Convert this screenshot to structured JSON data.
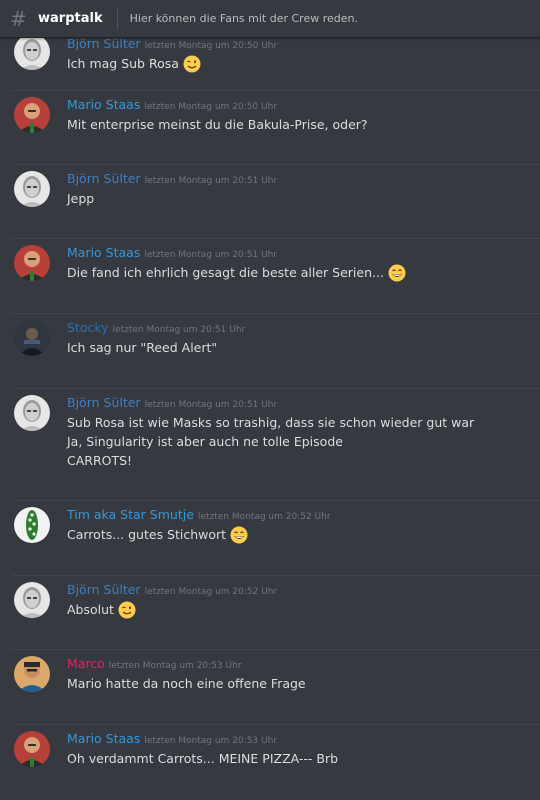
{
  "channel": {
    "name": "warptalk",
    "topic": "Hier können die Fans mit der Crew reden."
  },
  "colors": {
    "bjoern": "#3d7fc2",
    "mario": "#3498db",
    "stocky": "#2d6fb0",
    "tim": "#3498db",
    "marco": "#e91e63"
  },
  "messages": [
    {
      "author": "Björn Sülter",
      "color_key": "bjoern",
      "avatar": "bjoern-avatar",
      "time": "letzten Montag um 20:50 Uhr",
      "lines": [
        {
          "text": "Ich mag Sub Rosa",
          "emoji": "wink-emoji"
        }
      ]
    },
    {
      "author": "Mario Staas",
      "color_key": "mario",
      "avatar": "mario-avatar",
      "time": "letzten Montag um 20:50 Uhr",
      "lines": [
        {
          "text": "Mit enterprise meinst du die Bakula-Prise, oder?"
        }
      ]
    },
    {
      "author": "Björn Sülter",
      "color_key": "bjoern",
      "avatar": "bjoern-avatar",
      "time": "letzten Montag um 20:51 Uhr",
      "lines": [
        {
          "text": "Jepp"
        }
      ]
    },
    {
      "author": "Mario Staas",
      "color_key": "mario",
      "avatar": "mario-avatar",
      "time": "letzten Montag um 20:51 Uhr",
      "lines": [
        {
          "text": "Die fand ich ehrlich gesagt die beste aller Serien...",
          "emoji": "smile-emoji"
        }
      ]
    },
    {
      "author": "Stocky",
      "color_key": "stocky",
      "avatar": "stocky-avatar",
      "time": "letzten Montag um 20:51 Uhr",
      "lines": [
        {
          "text": "Ich sag nur \"Reed Alert\""
        }
      ]
    },
    {
      "author": "Björn Sülter",
      "color_key": "bjoern",
      "avatar": "bjoern-avatar",
      "time": "letzten Montag um 20:51 Uhr",
      "lines": [
        {
          "text": "Sub Rosa ist wie Masks so trashig, dass sie schon wieder gut war"
        },
        {
          "text": "Ja, Singularity ist aber auch ne tolle Episode"
        },
        {
          "text": "CARROTS!"
        }
      ]
    },
    {
      "author": "Tim aka Star Smutje",
      "color_key": "tim",
      "avatar": "tim-avatar",
      "time": "letzten Montag um 20:52 Uhr",
      "lines": [
        {
          "text": "Carrots... gutes Stichwort",
          "emoji": "smile-emoji"
        }
      ]
    },
    {
      "author": "Björn Sülter",
      "color_key": "bjoern",
      "avatar": "bjoern-avatar",
      "time": "letzten Montag um 20:52 Uhr",
      "lines": [
        {
          "text": "Absolut",
          "emoji": "wink-emoji"
        }
      ]
    },
    {
      "author": "Marco",
      "color_key": "marco",
      "avatar": "marco-avatar",
      "time": "letzten Montag um 20:53 Uhr",
      "lines": [
        {
          "text": "Mario hatte da noch eine offene Frage"
        }
      ]
    },
    {
      "author": "Mario Staas",
      "color_key": "mario",
      "avatar": "mario-avatar",
      "time": "letzten Montag um 20:53 Uhr",
      "lines": [
        {
          "text": "Oh verdammt Carrots... MEINE PIZZA--- Brb"
        }
      ]
    }
  ]
}
